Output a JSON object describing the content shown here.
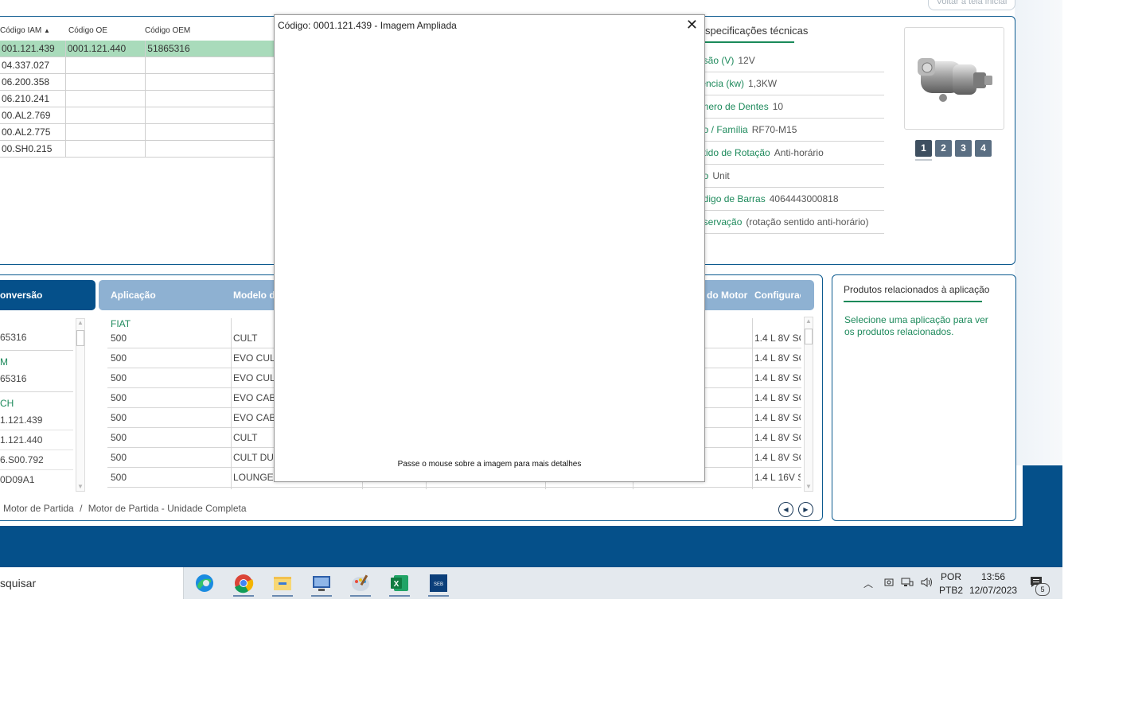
{
  "header": {
    "back_button": "Voltar à tela inicial"
  },
  "codes_table": {
    "columns": [
      "Código IAM",
      "Código OE",
      "Código OEM"
    ],
    "sort_indicator": "▲",
    "rows": [
      [
        "001.121.439",
        "0001.121.440",
        "51865316"
      ],
      [
        "04.337.027",
        "",
        ""
      ],
      [
        "06.200.358",
        "",
        ""
      ],
      [
        "06.210.241",
        "",
        ""
      ],
      [
        "00.AL2.769",
        "",
        ""
      ],
      [
        "00.AL2.775",
        "",
        ""
      ],
      [
        "00.SH0.215",
        "",
        ""
      ]
    ]
  },
  "specs": {
    "title": "specificações técnicas",
    "rows": [
      {
        "label": "nsão (V)",
        "value": "12V"
      },
      {
        "label": "tência (kw)",
        "value": "1,3KW"
      },
      {
        "label": "ímero de Dentes",
        "value": "10"
      },
      {
        "label": "po / Família",
        "value": "RF70-M15"
      },
      {
        "label": "ntido de Rotação",
        "value": "Anti-horário"
      },
      {
        "label": "po",
        "value": "Unit"
      },
      {
        "label": "ódigo de Barras",
        "value": "4064443000818"
      },
      {
        "label": "oservação",
        "value": "(rotação sentido anti-horário)"
      }
    ]
  },
  "image_pager": [
    "1",
    "2",
    "3",
    "4"
  ],
  "conversion": {
    "header": "onversão",
    "groups": [
      {
        "brand": "",
        "codes": [
          "65316"
        ]
      },
      {
        "brand": "M",
        "codes": [
          "65316"
        ]
      },
      {
        "brand": "CH",
        "codes": [
          "1.121.439",
          "1.121.440",
          "6.S00.792",
          "0D09A1"
        ]
      }
    ]
  },
  "application": {
    "headers": [
      "Aplicação",
      "Modelo d",
      "do Motor",
      "Configurаç"
    ],
    "brand": "FIAT",
    "rows": [
      {
        "app": "500",
        "model": "CULT",
        "config": "1.4 L 8V SO"
      },
      {
        "app": "500",
        "model": "EVO CUL",
        "config": "1.4 L 8V SO"
      },
      {
        "app": "500",
        "model": "EVO CUL",
        "config": "1.4 L 8V SO"
      },
      {
        "app": "500",
        "model": "EVO CAB",
        "config": "1.4 L 8V SO"
      },
      {
        "app": "500",
        "model": "EVO CAB",
        "config": "1.4 L 8V SO"
      },
      {
        "app": "500",
        "model": "CULT",
        "config": "1.4 L 8V SO"
      },
      {
        "app": "500",
        "model": "CULT DU",
        "config": "1.4 L 8V SO"
      },
      {
        "app": "500",
        "model": "LOUNGE",
        "config": "1.4 L 16V S"
      }
    ]
  },
  "breadcrumb": [
    "Motor de Partida",
    "/",
    "Motor de Partida - Unidade Completa"
  ],
  "related": {
    "title": "Produtos relacionados à aplicação",
    "text": "Selecione uma aplicação para ver os produtos relacionados."
  },
  "modal": {
    "title": "Código: 0001.121.439 - Imagem Ampliada",
    "close": "✕",
    "hint": "Passe o mouse sobre a imagem para mais detalhes"
  },
  "taskbar": {
    "search": "squisar",
    "apps": [
      "edge-icon",
      "chrome-icon",
      "file-explorer-icon",
      "remote-desktop-icon",
      "paint-icon",
      "excel-icon",
      "seb-app-icon"
    ],
    "lang_line1": "POR",
    "lang_line2": "PTB2",
    "time": "13:56",
    "date": "12/07/2023",
    "notification_count": "5"
  },
  "colors": {
    "brand_blue": "#05508a",
    "accent_green": "#1e8a5c",
    "selected_row": "#a9dbbb",
    "header_light_blue": "#8eb1d2"
  }
}
